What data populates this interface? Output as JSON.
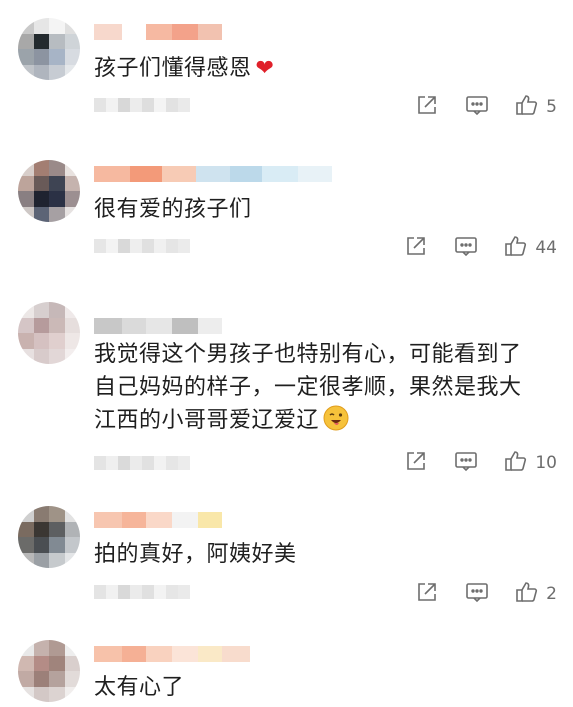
{
  "comments": [
    {
      "text": "孩子们懂得感恩",
      "trailing_emoji": "heart",
      "likes": "5",
      "avatar_colors": [
        "#c9c9c9",
        "#e6e6e6",
        "#f4f4f4",
        "#dfdfdf",
        "#a8a8a8",
        "#222a2f",
        "#b7bcc2",
        "#cfd4d8",
        "#9aa3ab",
        "#8b94a3",
        "#a6b4c8",
        "#d7dbe2",
        "#c0c4ca",
        "#aeb5bf",
        "#c7ccd4",
        "#e4e7ea"
      ],
      "name_colors": [
        "#f7d8cc",
        "#ffffff",
        "#f6b9a2",
        "#f3a28a",
        "#f2c2b0"
      ],
      "meta_colors": [
        "#e4e4e4",
        "#f2f2f2",
        "#d8d8d8",
        "#ececec",
        "#dedede",
        "#f4f4f4",
        "#e2e2e2",
        "#eaeaea"
      ]
    },
    {
      "text": "很有爱的孩子们",
      "trailing_emoji": "",
      "likes": "44",
      "avatar_colors": [
        "#d9cec9",
        "#a67d70",
        "#9b8a88",
        "#e9e2df",
        "#bfa39a",
        "#6a5a57",
        "#3d4455",
        "#c7b3ad",
        "#8a7f82",
        "#1f2331",
        "#2a3147",
        "#9d8f91",
        "#cfc8c6",
        "#5b6478",
        "#a7a0a3",
        "#e6e2e1"
      ],
      "name_colors": [
        "#f6b9a0",
        "#f39a79",
        "#f7cbb5",
        "#cfe3ef",
        "#bcd9ea",
        "#d9ecf5",
        "#e8f2f7"
      ],
      "meta_colors": [
        "#e6e6e6",
        "#f3f3f3",
        "#d9d9d9",
        "#eeeeee",
        "#e0e0e0",
        "#f0f0f0",
        "#e5e5e5",
        "#ebebeb"
      ]
    },
    {
      "text": "我觉得这个男孩子也特别有心，可能看到了\n自己妈妈的样子，一定很孝顺，果然是我大\n江西的小哥哥爱辽爱辽",
      "trailing_emoji": "wink",
      "likes": "10",
      "avatar_colors": [
        "#ece7e6",
        "#d8cfcf",
        "#c7b8b8",
        "#efe9e9",
        "#d6c5c6",
        "#b89a9c",
        "#cdb9b6",
        "#e7dedd",
        "#cbb1ae",
        "#d7c1c1",
        "#e1cfcd",
        "#efe7e6",
        "#e8e0e0",
        "#d9cbcb",
        "#e3d7d7",
        "#f3eeee"
      ],
      "name_colors": [
        "#c8c8c8",
        "#dadada",
        "#e6e6e6",
        "#bfbfbf",
        "#ededed"
      ],
      "meta_colors": [
        "#e4e4e4",
        "#efefef",
        "#dadada",
        "#ebebeb",
        "#e1e1e1",
        "#f2f2f2",
        "#e6e6e6",
        "#ececec"
      ]
    },
    {
      "text": "拍的真好，阿姨好美",
      "trailing_emoji": "",
      "likes": "2",
      "avatar_colors": [
        "#cfcfcf",
        "#8a7b70",
        "#a09386",
        "#e2e2e2",
        "#7b6b5e",
        "#3b3733",
        "#5d5f61",
        "#b0b3b6",
        "#6b6b69",
        "#4a4e52",
        "#808a94",
        "#c3c7cb",
        "#b8b8b8",
        "#9aa0a6",
        "#c6cacd",
        "#e3e5e7"
      ],
      "name_colors": [
        "#f7c6b0",
        "#f6b59a",
        "#fad8c8",
        "#f3f3f3",
        "#f9e7a9"
      ],
      "meta_colors": [
        "#e4e4e4",
        "#f1f1f1",
        "#d9d9d9",
        "#ebebeb",
        "#e0e0e0",
        "#f3f3f3",
        "#e6e6e6",
        "#eaeaea"
      ]
    },
    {
      "text": "太有心了",
      "trailing_emoji": "",
      "likes": "",
      "avatar_colors": [
        "#e9e9e9",
        "#c7b2ac",
        "#b29a92",
        "#eeeeee",
        "#d2b8b0",
        "#b88b84",
        "#a2837b",
        "#dacfcc",
        "#c3a9a3",
        "#9e7f78",
        "#b7a29c",
        "#e3dbd9",
        "#e6e2e1",
        "#d4c8c5",
        "#ddd3d1",
        "#f1eeed"
      ],
      "name_colors": [
        "#f7c2aa",
        "#f5b095",
        "#f9d2bf",
        "#fbe4d8",
        "#fae9c7",
        "#f8dccd"
      ],
      "meta_colors": []
    }
  ],
  "colors": {
    "icon": "#6d6d6d",
    "heart": "#e0202a",
    "text": "#1f1f1f"
  }
}
